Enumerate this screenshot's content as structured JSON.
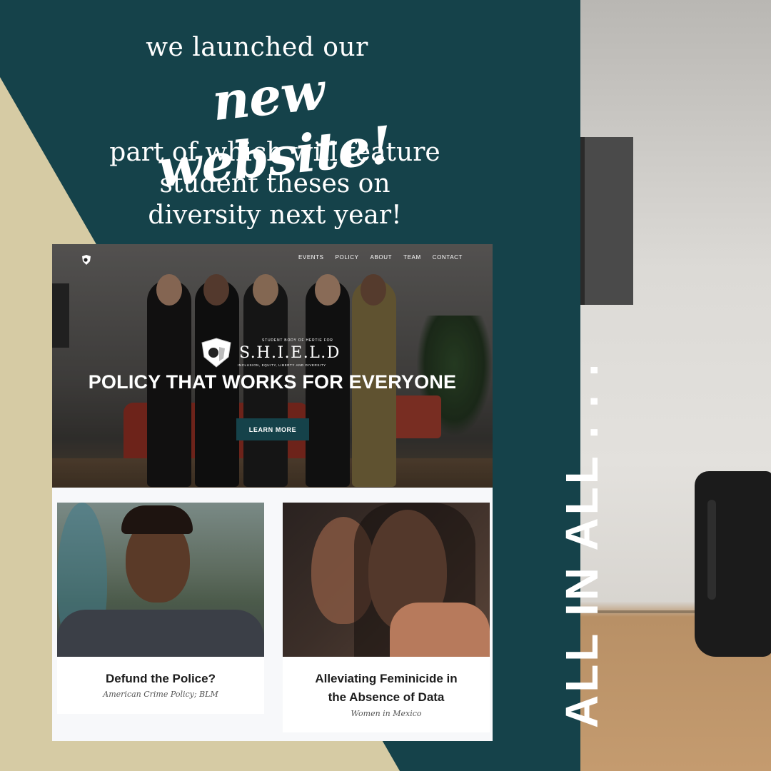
{
  "headline": {
    "line1": "we launched our",
    "script": "new website!",
    "line3a": "part of which will feature",
    "line3b": "student theses on",
    "line3c": "diversity next year!"
  },
  "vertical_text": "ALL IN ALL . . .",
  "colors": {
    "panel": "#15424a",
    "tan": "#d6cba4",
    "button": "#15424a"
  },
  "site": {
    "nav": [
      "EVENTS",
      "POLICY",
      "ABOUT",
      "TEAM",
      "CONTACT"
    ],
    "logo_icon": "shield-icon",
    "emblem": {
      "small": "STUDENT BODY OF HERTIE FOR",
      "name": "S.H.I.E.L.D",
      "tagline": "INCLUSION, EQUITY, LIBERTY AND DIVERSITY"
    },
    "hero_title": "POLICY THAT WORKS FOR EVERYONE",
    "hero_button": "LEARN MORE",
    "cards": [
      {
        "title": "Defund the Police?",
        "subtitle": "American Crime Policy; BLM"
      },
      {
        "title_line1": "Alleviating Feminicide in",
        "title_line2": "the Absence of Data",
        "subtitle": "Women in Mexico"
      }
    ]
  }
}
